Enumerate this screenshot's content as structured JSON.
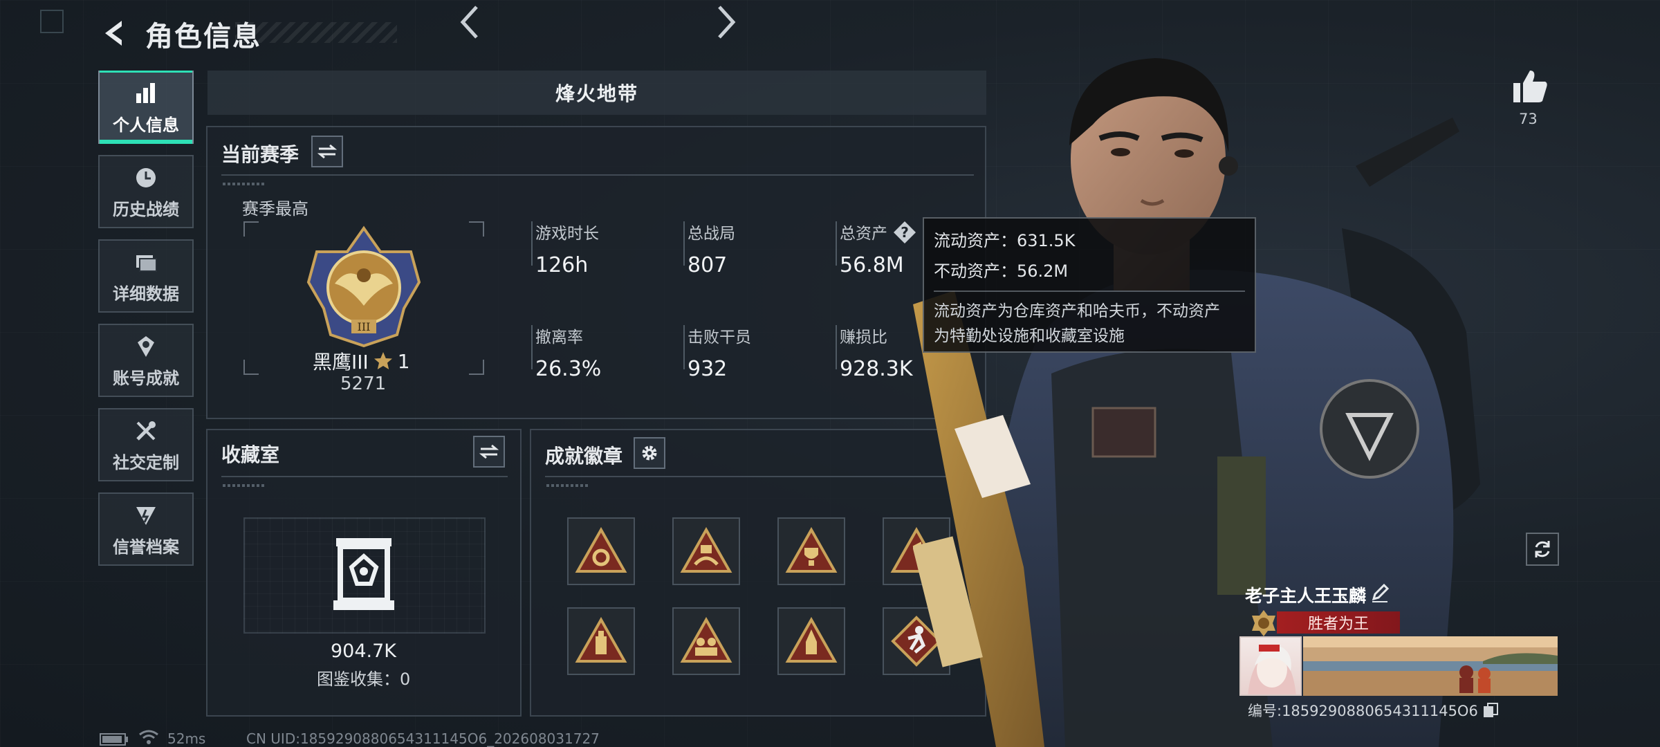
{
  "header": {
    "title": "角色信息",
    "back_icon": "back-arrow-icon"
  },
  "sidebar": {
    "items": [
      {
        "label": "个人信息",
        "icon": "bar-chart-icon",
        "active": true
      },
      {
        "label": "历史战绩",
        "icon": "clock-icon",
        "active": false
      },
      {
        "label": "详细数据",
        "icon": "folder-icon",
        "active": false
      },
      {
        "label": "账号成就",
        "icon": "achievement-icon",
        "active": false
      },
      {
        "label": "社交定制",
        "icon": "tools-icon",
        "active": false
      },
      {
        "label": "信誉档案",
        "icon": "reputation-icon",
        "active": false
      }
    ]
  },
  "mode": {
    "title": "烽火地带"
  },
  "season": {
    "title": "当前赛季",
    "best_label": "赛季最高",
    "rank_name": "黑鹰III",
    "rank_stars": "1",
    "rank_score": "5271",
    "stats": [
      {
        "label": "游戏时长",
        "value": "126h"
      },
      {
        "label": "总战局",
        "value": "807"
      },
      {
        "label": "总资产",
        "value": "56.8M"
      },
      {
        "label": "撤离率",
        "value": "26.3%"
      },
      {
        "label": "击败干员",
        "value": "932"
      },
      {
        "label": "赚损比",
        "value": "928.3K"
      }
    ]
  },
  "tooltip": {
    "liquid": "流动资产：631.5K",
    "fixed": "不动资产：56.2M",
    "desc_line1": "流动资产为仓库资产和哈夫币，不动资产",
    "desc_line2": "为特勤处设施和收藏室设施"
  },
  "collection": {
    "title": "收藏室",
    "value": "904.7K",
    "catalog": "图鉴收集：0"
  },
  "achievements": {
    "title": "成就徽章",
    "badge_count": 8
  },
  "profile": {
    "likes": "73",
    "name": "老子主人王玉麟",
    "title": "胜者为王",
    "id": "编号:1859290880654311145O6"
  },
  "status_bar": {
    "ping": "52ms",
    "uid": "CN UID:1859290880654311145O6_202608031727"
  },
  "colors": {
    "accent": "#2ee0b6",
    "title_red": "#aa1e1e",
    "gold": "#c9a25a"
  }
}
